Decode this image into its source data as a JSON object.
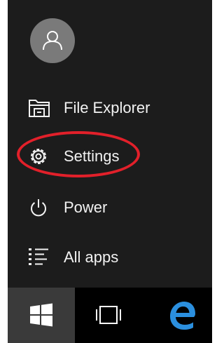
{
  "user": {
    "avatar_icon": "user-avatar-icon"
  },
  "menu": {
    "items": [
      {
        "label": "File Explorer",
        "icon": "file-explorer-icon"
      },
      {
        "label": "Settings",
        "icon": "gear-icon"
      },
      {
        "label": "Power",
        "icon": "power-icon"
      },
      {
        "label": "All apps",
        "icon": "all-apps-list-icon"
      }
    ]
  },
  "annotation": {
    "highlighted_item": "Settings",
    "color": "#e2202a"
  },
  "taskbar": {
    "buttons": [
      {
        "icon": "windows-start-icon",
        "active": true
      },
      {
        "icon": "task-view-icon",
        "active": false
      },
      {
        "icon": "edge-browser-icon",
        "active": false
      }
    ]
  },
  "colors": {
    "menu_background": "#1c1c1c",
    "taskbar_background": "#000000",
    "start_button_active": "#3a3a3a",
    "text": "#f2f2f2",
    "avatar_background": "#7a7a7a",
    "edge_blue": "#2b8fde"
  }
}
